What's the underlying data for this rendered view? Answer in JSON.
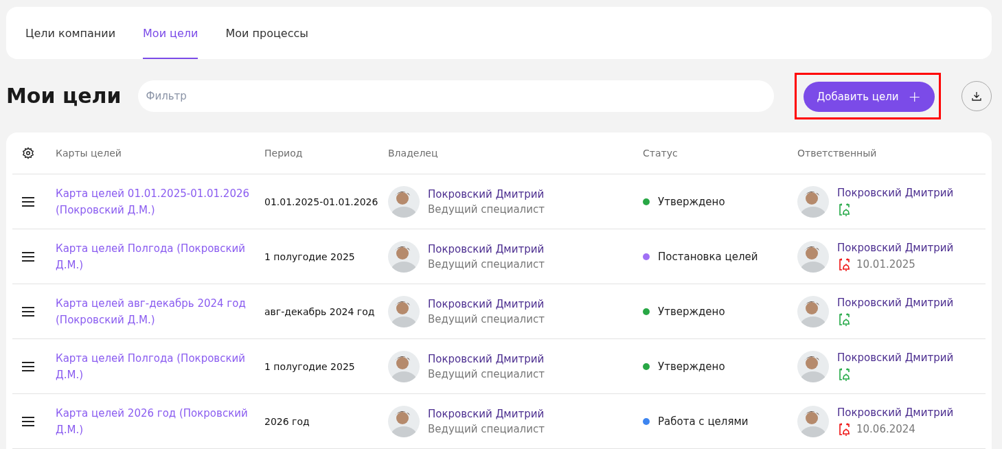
{
  "tabs": [
    {
      "label": "Цели компании",
      "selected": false
    },
    {
      "label": "Мои цели",
      "selected": true
    },
    {
      "label": "Мои процессы",
      "selected": false
    }
  ],
  "title": "Мои цели",
  "filter": {
    "placeholder": "Фильтр"
  },
  "add_button": {
    "label": "Добавить цели",
    "icon": "+",
    "highlighted": true
  },
  "table": {
    "columns": [
      "Карты целей",
      "Период",
      "Владелец",
      "Статус",
      "Ответственный"
    ],
    "rows": [
      {
        "map": "Карта целей 01.01.2025-01.01.2026 (Покровский Д.М.)",
        "period": "01.01.2025-01.01.2026",
        "owner": "Покровский Дмитрий",
        "owner_role": "Ведущий специалист",
        "status": "Утверждено",
        "color": "#28a745",
        "responsible": "Покровский Дмитрий",
        "overdue": false
      },
      {
        "map": "Карта целей Полгода (Покровский Д.М.)",
        "period": "1 полугодие 2025",
        "owner": "Покровский Дмитрий",
        "owner_role": "Ведущий специалист",
        "status": "Постановка целей",
        "color": "#a070f5",
        "responsible": "Покровский Дмитрий",
        "overdue": true,
        "due": "10.01.2025"
      },
      {
        "map": "Карта целей авг-декабрь 2024 год (Покровский Д.М.)",
        "period": "авг-декабрь 2024 год",
        "owner": "Покровский Дмитрий",
        "owner_role": "Ведущий специалист",
        "status": "Утверждено",
        "color": "#28a745",
        "responsible": "Покровский Дмитрий",
        "overdue": false
      },
      {
        "map": "Карта целей Полгода (Покровский Д.М.)",
        "period": "1 полугодие 2025",
        "owner": "Покровский Дмитрий",
        "owner_role": "Ведущий специалист",
        "status": "Утверждено",
        "color": "#28a745",
        "responsible": "Покровский Дмитрий",
        "overdue": false
      },
      {
        "map": "Карта целей 2026 год (Покровский Д.М.)",
        "period": "2026 год",
        "owner": "Покровский Дмитрий",
        "owner_role": "Ведущий специалист",
        "status": "Работа с целями",
        "color": "#3d85f0",
        "responsible": "Покровский Дмитрий",
        "overdue": true,
        "due": "10.06.2024"
      }
    ]
  }
}
